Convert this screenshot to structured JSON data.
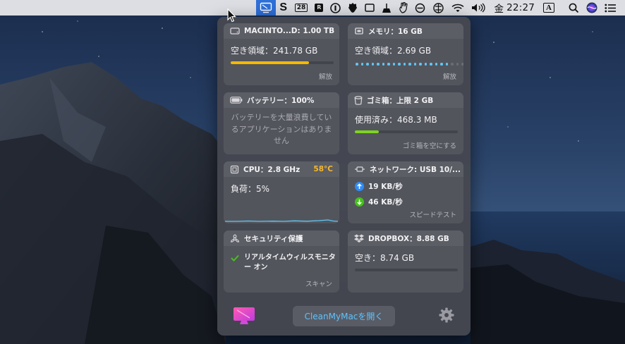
{
  "menubar": {
    "items": [
      {
        "icon": "cleanmymac-icon"
      },
      {
        "icon": "s-app-icon"
      },
      {
        "icon": "calendar-icon",
        "text": "28"
      },
      {
        "icon": "r-app-icon",
        "text": "R"
      },
      {
        "icon": "1password-icon"
      },
      {
        "icon": "shield-icon"
      },
      {
        "icon": "window-icon"
      },
      {
        "icon": "broom-icon"
      },
      {
        "icon": "hand-icon"
      },
      {
        "icon": "no-entry-icon"
      },
      {
        "icon": "vpn-icon"
      },
      {
        "icon": "wifi-icon"
      },
      {
        "icon": "volume-icon"
      }
    ],
    "clock_day": "金",
    "clock_time": "22:27",
    "input_source": "A",
    "right_icons": [
      "search-icon",
      "siri-icon",
      "list-icon"
    ]
  },
  "panel": {
    "disk": {
      "title": "MACINTO...D: 1.00 TB",
      "value": "空き領域：241.78 GB",
      "used_fraction": 0.76,
      "bar_color": "#f5b800",
      "action": "解放"
    },
    "memory": {
      "title": "メモリ：16 GB",
      "value": "空き領域：2.69 GB",
      "dots_total": 22,
      "dots_active": 18,
      "dot_color": "#62c6f5",
      "action": "解放"
    },
    "battery": {
      "title": "バッテリー：100%",
      "message": "バッテリーを大量浪費しているアプリケーションはありません"
    },
    "trash": {
      "title": "ゴミ箱：上限 2 GB",
      "value": "使用済み：468.3 MB",
      "used_fraction": 0.23,
      "bar_color": "#7ed321",
      "action": "ゴミ箱を空にする"
    },
    "cpu": {
      "title": "CPU：2.8 GHz",
      "temp": "58°C",
      "value": "負荷：5%",
      "graph_color": "#62c6f5"
    },
    "network": {
      "title": "ネットワーク: USB 10/...",
      "upload": "19 KB/秒",
      "download": "46 KB/秒",
      "action": "スピードテスト",
      "upload_color": "#2f8cf5",
      "download_color": "#45c21b"
    },
    "security": {
      "title": "セキュリティ保護",
      "status": "リアルタイムウィルスモニター オン",
      "action": "スキャン",
      "check_color": "#45c21b"
    },
    "dropbox": {
      "title": "DROPBOX：8.88 GB",
      "value": "空き：8.74 GB",
      "used_fraction": 0.0
    },
    "footer": {
      "open_button": "CleanMyMacを開く",
      "button_text_color": "#5dc3ff"
    }
  }
}
